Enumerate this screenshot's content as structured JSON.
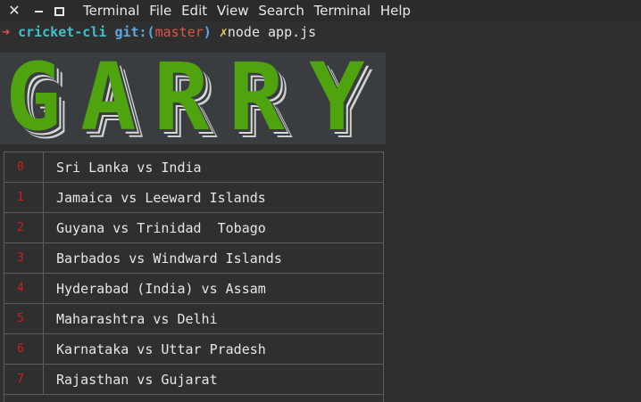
{
  "window": {
    "menu": [
      "Terminal",
      "File",
      "Edit",
      "View",
      "Search",
      "Terminal",
      "Help"
    ]
  },
  "prompt": {
    "arrow": "➜",
    "directory": "cricket-cli",
    "git_label": "git:(",
    "branch": "master",
    "git_close": ")",
    "dirty_mark": "✗",
    "command": "node app.js"
  },
  "banner": {
    "letters": [
      "G",
      "A",
      "R",
      "R",
      "Y"
    ],
    "color": "#4fa30e"
  },
  "matches": [
    {
      "index": "0",
      "title": "Sri Lanka vs India"
    },
    {
      "index": "1",
      "title": "Jamaica vs Leeward Islands"
    },
    {
      "index": "2",
      "title": "Guyana vs Trinidad  Tobago"
    },
    {
      "index": "3",
      "title": "Barbados vs Windward Islands"
    },
    {
      "index": "4",
      "title": "Hyderabad (India) vs Assam"
    },
    {
      "index": "5",
      "title": "Maharashtra vs Delhi"
    },
    {
      "index": "6",
      "title": "Karnataka vs Uttar Pradesh"
    },
    {
      "index": "7",
      "title": "Rajasthan vs Gujarat"
    }
  ]
}
